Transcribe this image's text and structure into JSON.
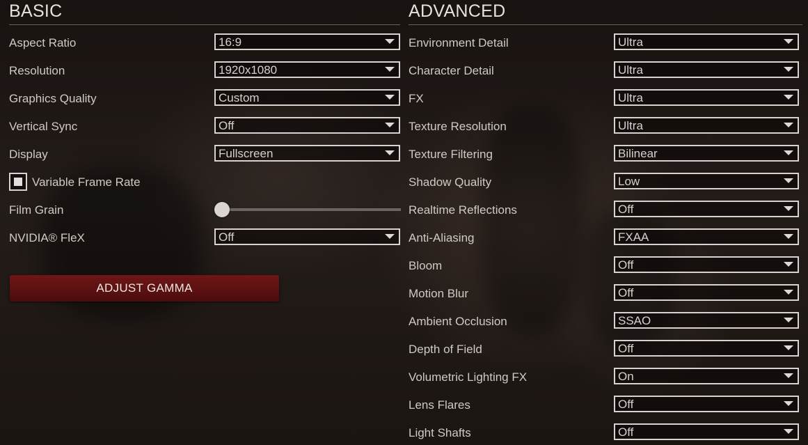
{
  "basic": {
    "title": "BASIC",
    "settings": [
      {
        "label": "Aspect Ratio",
        "value": "16:9"
      },
      {
        "label": "Resolution",
        "value": "1920x1080"
      },
      {
        "label": "Graphics Quality",
        "value": "Custom"
      },
      {
        "label": "Vertical Sync",
        "value": "Off"
      },
      {
        "label": "Display",
        "value": "Fullscreen"
      }
    ],
    "variable_frame_rate": {
      "label": "Variable Frame Rate",
      "checked": true
    },
    "film_grain": {
      "label": "Film Grain",
      "level": 0
    },
    "nvidia_flex": {
      "label": "NVIDIA® FleX",
      "value": "Off"
    },
    "adjust_gamma_label": "ADJUST GAMMA"
  },
  "advanced": {
    "title": "ADVANCED",
    "settings": [
      {
        "label": "Environment Detail",
        "value": "Ultra"
      },
      {
        "label": "Character Detail",
        "value": "Ultra"
      },
      {
        "label": "FX",
        "value": "Ultra"
      },
      {
        "label": "Texture Resolution",
        "value": "Ultra"
      },
      {
        "label": "Texture Filtering",
        "value": "Bilinear"
      },
      {
        "label": "Shadow Quality",
        "value": "Low"
      },
      {
        "label": "Realtime Reflections",
        "value": "Off"
      },
      {
        "label": "Anti-Aliasing",
        "value": "FXAA"
      },
      {
        "label": "Bloom",
        "value": "Off"
      },
      {
        "label": "Motion Blur",
        "value": "Off"
      },
      {
        "label": "Ambient Occlusion",
        "value": "SSAO"
      },
      {
        "label": "Depth of Field",
        "value": "Off"
      },
      {
        "label": "Volumetric Lighting FX",
        "value": "On"
      },
      {
        "label": "Lens Flares",
        "value": "Off"
      },
      {
        "label": "Light Shafts",
        "value": "Off"
      }
    ]
  },
  "colors": {
    "accent": "#5e1212",
    "text": "#d4d0cb",
    "border": "#d8d3ce"
  }
}
